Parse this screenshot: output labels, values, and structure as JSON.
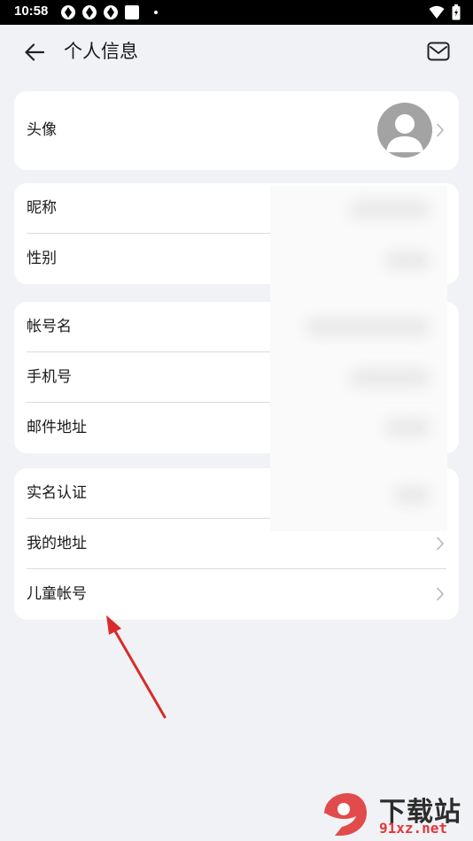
{
  "status": {
    "time": "10:58"
  },
  "header": {
    "title": "个人信息"
  },
  "groups": {
    "avatar": {
      "label": "头像"
    },
    "basic": [
      {
        "label": "昵称"
      },
      {
        "label": "性别"
      }
    ],
    "account": [
      {
        "label": "帐号名"
      },
      {
        "label": "手机号"
      },
      {
        "label": "邮件地址"
      }
    ],
    "other": [
      {
        "label": "实名认证"
      },
      {
        "label": "我的地址"
      },
      {
        "label": "儿童帐号"
      }
    ]
  },
  "watermark": {
    "brand": "下载站",
    "logo_text": "9",
    "url": "91xz.net"
  },
  "colors": {
    "background": "#f1f2f6",
    "card": "#ffffff",
    "arrow": "#d92b2b",
    "watermark_red": "#e0393a"
  },
  "icons": [
    "back-arrow-icon",
    "mail-icon",
    "chevron-right-icon",
    "avatar-placeholder-icon",
    "wifi-icon",
    "battery-icon"
  ]
}
